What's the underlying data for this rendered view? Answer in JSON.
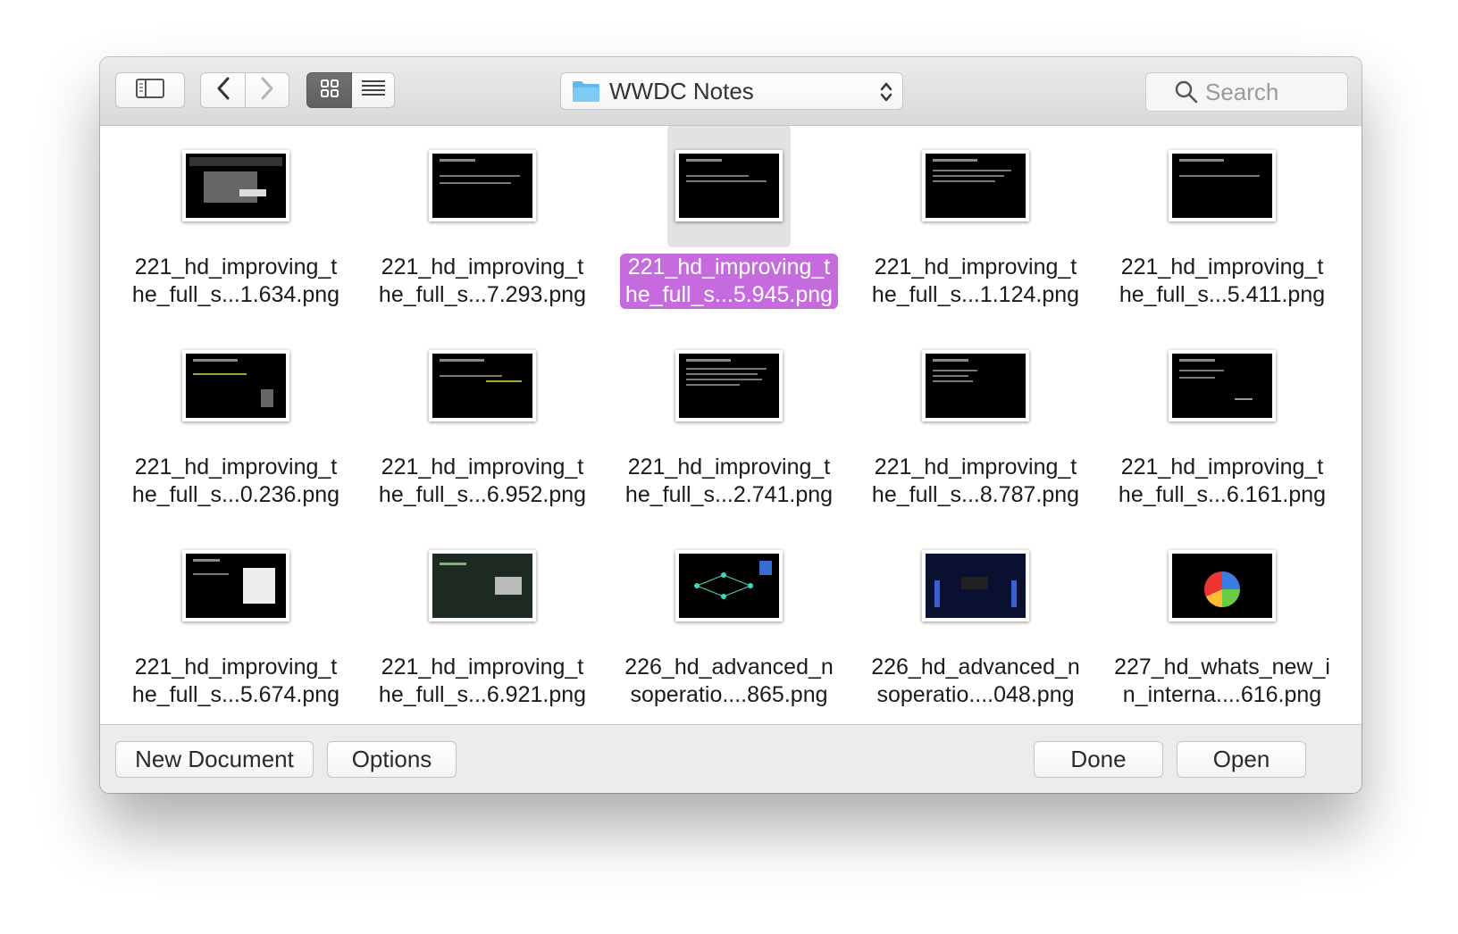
{
  "window": {
    "title": "Open dialog"
  },
  "toolbar": {
    "sidebar_icon": "sidebar-toggle-icon",
    "back_icon": "chevron-left-icon",
    "forward_icon": "chevron-right-icon",
    "grid_view_icon": "grid-icon",
    "list_view_icon": "list-icon",
    "folder_name": "WWDC Notes",
    "search_placeholder": "Search"
  },
  "files": [
    {
      "line1": "221_hd_improving_t",
      "line2": "he_full_s...1.634.png",
      "selected": false
    },
    {
      "line1": "221_hd_improving_t",
      "line2": "he_full_s...7.293.png",
      "selected": false
    },
    {
      "line1": "221_hd_improving_t",
      "line2": "he_full_s...5.945.png",
      "selected": true
    },
    {
      "line1": "221_hd_improving_t",
      "line2": "he_full_s...1.124.png",
      "selected": false
    },
    {
      "line1": "221_hd_improving_t",
      "line2": "he_full_s...5.411.png",
      "selected": false
    },
    {
      "line1": "221_hd_improving_t",
      "line2": "he_full_s...0.236.png",
      "selected": false
    },
    {
      "line1": "221_hd_improving_t",
      "line2": "he_full_s...6.952.png",
      "selected": false
    },
    {
      "line1": "221_hd_improving_t",
      "line2": "he_full_s...2.741.png",
      "selected": false
    },
    {
      "line1": "221_hd_improving_t",
      "line2": "he_full_s...8.787.png",
      "selected": false
    },
    {
      "line1": "221_hd_improving_t",
      "line2": "he_full_s...6.161.png",
      "selected": false
    },
    {
      "line1": "221_hd_improving_t",
      "line2": "he_full_s...5.674.png",
      "selected": false
    },
    {
      "line1": "221_hd_improving_t",
      "line2": "he_full_s...6.921.png",
      "selected": false
    },
    {
      "line1": "226_hd_advanced_n",
      "line2": "soperatio....865.png",
      "selected": false
    },
    {
      "line1": "226_hd_advanced_n",
      "line2": "soperatio....048.png",
      "selected": false
    },
    {
      "line1": "227_hd_whats_new_i",
      "line2": "n_interna....616.png",
      "selected": false
    }
  ],
  "buttons": {
    "new_document": "New Document",
    "options": "Options",
    "done": "Done",
    "open": "Open"
  },
  "colors": {
    "selection": "#c66bde",
    "folder": "#5fb8ef"
  }
}
